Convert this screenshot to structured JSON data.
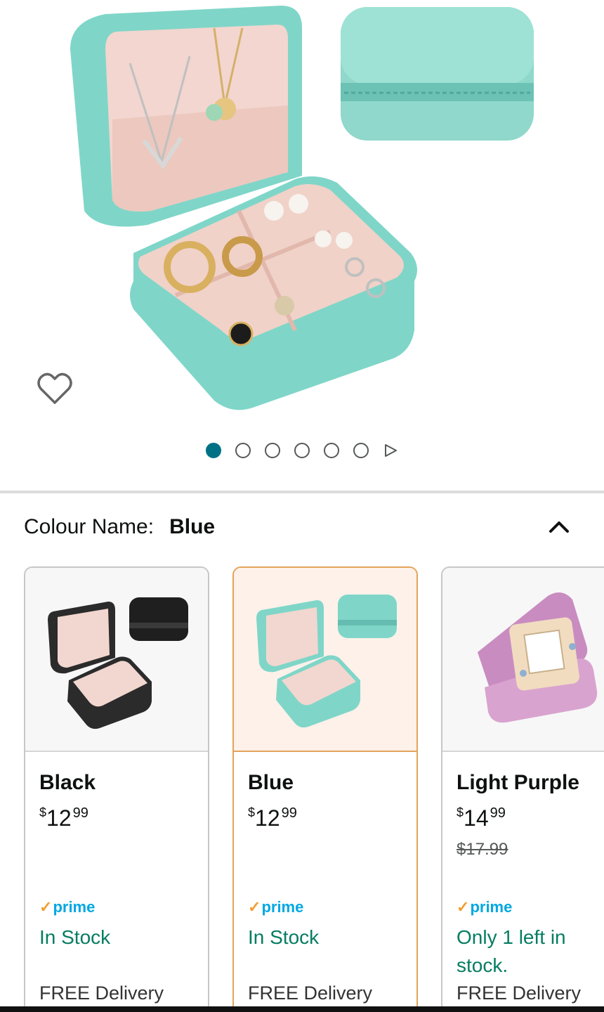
{
  "gallery": {
    "image_count": 6,
    "active_index": 0,
    "icons": {
      "wishlist": "heart-outline-icon",
      "next": "play-triangle-icon"
    }
  },
  "variant": {
    "label": "Colour Name:",
    "selected": "Blue",
    "collapse_icon": "chevron-up-icon"
  },
  "swatches": [
    {
      "name": "Black",
      "price_dollars": "12",
      "price_cents": "99",
      "currency": "$",
      "was_price": "",
      "prime": "prime",
      "stock": "In Stock",
      "delivery": "FREE Delivery",
      "box_color": "#2b2b2b"
    },
    {
      "name": "Blue",
      "price_dollars": "12",
      "price_cents": "99",
      "currency": "$",
      "was_price": "",
      "prime": "prime",
      "stock": "In Stock",
      "delivery": "FREE Delivery",
      "box_color": "#7fd6c8"
    },
    {
      "name": "Light Purple",
      "price_dollars": "14",
      "price_cents": "99",
      "currency": "$",
      "was_price": "$17.99",
      "prime": "prime",
      "stock": "Only 1 left in stock.",
      "delivery": "FREE Delivery",
      "box_color": "#c98cc0"
    }
  ],
  "colors": {
    "accent_teal": "#007185",
    "selected_border": "#e3a45a",
    "stock_green": "#067d62",
    "prime_blue": "#00a8e1"
  }
}
